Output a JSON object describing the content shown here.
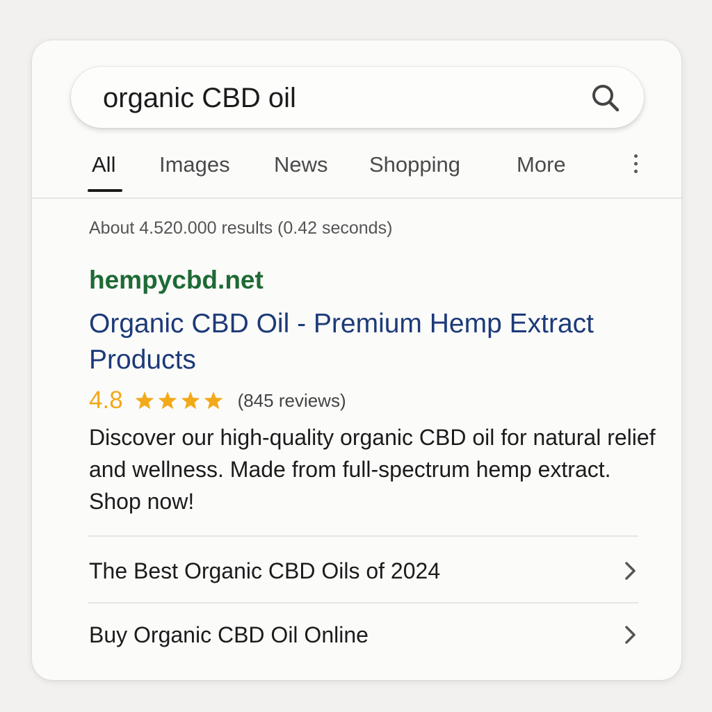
{
  "search": {
    "query": "organic CBD oil",
    "icon": "search-icon"
  },
  "tabs": [
    {
      "label": "All",
      "active": true
    },
    {
      "label": "Images",
      "active": false
    },
    {
      "label": "News",
      "active": false
    },
    {
      "label": "Shopping",
      "active": false
    },
    {
      "label": "More",
      "active": false
    }
  ],
  "results_info": "About 4.520.000 results (0.42 seconds)",
  "result": {
    "site": "hempycbd.net",
    "title": "Organic CBD Oil - Premium Hemp Extract Products",
    "rating": "4.8",
    "stars": 4,
    "reviews": "(845 reviews)",
    "snippet": "Discover our high-quality organic CBD oil for natural relief and wellness. Made from full-spectrum hemp extract. Shop now!"
  },
  "related": [
    {
      "label": "The Best Organic CBD Oils of 2024",
      "icon": "chevron-right-icon"
    },
    {
      "label": "Buy Organic CBD Oil Online",
      "icon": "chevron-right-icon"
    }
  ],
  "colors": {
    "site_green": "#1e6a35",
    "title_blue": "#1c3a78",
    "star_gold": "#f2a91a"
  }
}
